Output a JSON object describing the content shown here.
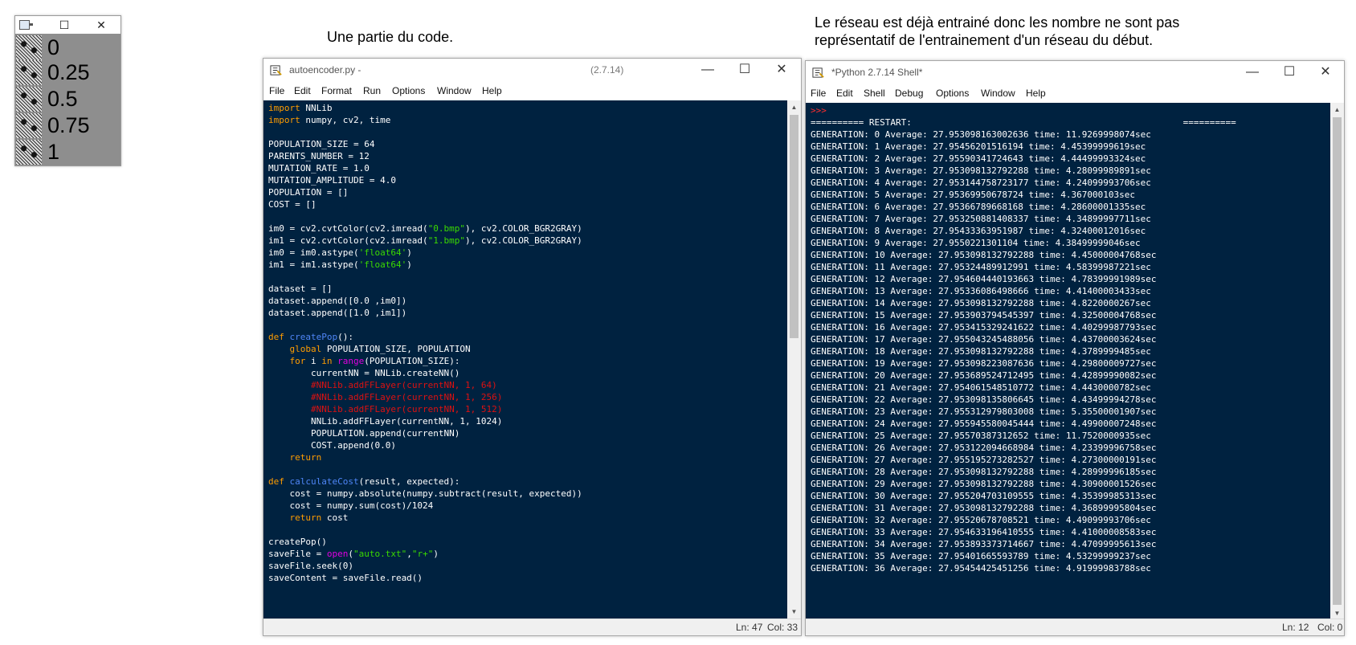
{
  "captions": {
    "code_note": "Une partie du code.",
    "shell_note_line1": "Le réseau est déjà entrainé donc les nombre ne sont pas",
    "shell_note_line2": "représentatif de l'entrainement d'un réseau du début."
  },
  "preview_window": {
    "minimize": "☐",
    "close": "✕",
    "rows": [
      "0",
      "0.25",
      "0.5",
      "0.75",
      "1"
    ]
  },
  "editor": {
    "title": "autoencoder.py -",
    "version": "(2.7.14)",
    "menu": [
      "File",
      "Edit",
      "Format",
      "Run",
      "Options",
      "Window",
      "Help"
    ],
    "status_ln": "Ln: 47",
    "status_col": "Col: 33",
    "colors": {
      "background": "#002240",
      "keyword": "#ff9d00",
      "builtin": "#e000e0",
      "def_name": "#4f86f7",
      "string": "#3ad900",
      "comment": "#dd1111"
    }
  },
  "shell": {
    "title": "*Python 2.7.14 Shell*",
    "menu": [
      "File",
      "Edit",
      "Shell",
      "Debug",
      "Options",
      "Window",
      "Help"
    ],
    "prompt": ">>>",
    "restart": "========== RESTART:                                                   ==========",
    "lines": [
      "GENERATION: 0 Average: 27.953098163002636 time: 11.9269998074sec",
      "GENERATION: 1 Average: 27.95456201516194 time: 4.45399999619sec",
      "GENERATION: 2 Average: 27.95590341724643 time: 4.44499993324sec",
      "GENERATION: 3 Average: 27.953098132792288 time: 4.28099989891sec",
      "GENERATION: 4 Average: 27.953144758723177 time: 4.24099993706sec",
      "GENERATION: 5 Average: 27.95369950678724 time: 4.367000103sec",
      "GENERATION: 6 Average: 27.95366789668168 time: 4.28600001335sec",
      "GENERATION: 7 Average: 27.953250881408337 time: 4.34899997711sec",
      "GENERATION: 8 Average: 27.95433363951987 time: 4.32400012016sec",
      "GENERATION: 9 Average: 27.9550221301104 time: 4.38499999046sec",
      "GENERATION: 10 Average: 27.953098132792288 time: 4.45000004768sec",
      "GENERATION: 11 Average: 27.95324489912991 time: 4.58399987221sec",
      "GENERATION: 12 Average: 27.954604440193663 time: 4.78399991989sec",
      "GENERATION: 13 Average: 27.95336086498666 time: 4.41400003433sec",
      "GENERATION: 14 Average: 27.953098132792288 time: 4.8220000267sec",
      "GENERATION: 15 Average: 27.953903794545397 time: 4.32500004768sec",
      "GENERATION: 16 Average: 27.953415329241622 time: 4.40299987793sec",
      "GENERATION: 17 Average: 27.955043245488056 time: 4.43700003624sec",
      "GENERATION: 18 Average: 27.953098132792288 time: 4.3789999485sec",
      "GENERATION: 19 Average: 27.953098223087636 time: 4.29800009727sec",
      "GENERATION: 20 Average: 27.953689524712495 time: 4.42899990082sec",
      "GENERATION: 21 Average: 27.954061548510772 time: 4.4430000782sec",
      "GENERATION: 22 Average: 27.953098135806645 time: 4.43499994278sec",
      "GENERATION: 23 Average: 27.955312979803008 time: 5.35500001907sec",
      "GENERATION: 24 Average: 27.955945580045444 time: 4.49900007248sec",
      "GENERATION: 25 Average: 27.95570387312652 time: 11.7520000935sec",
      "GENERATION: 26 Average: 27.953122094668984 time: 4.23399996758sec",
      "GENERATION: 27 Average: 27.955195273282527 time: 4.27300000191sec",
      "GENERATION: 28 Average: 27.953098132792288 time: 4.28999996185sec",
      "GENERATION: 29 Average: 27.953098132792288 time: 4.30900001526sec",
      "GENERATION: 30 Average: 27.955204703109555 time: 4.35399985313sec",
      "GENERATION: 31 Average: 27.953098132792288 time: 4.36899995804sec",
      "GENERATION: 32 Average: 27.95520678708521 time: 4.49099993706sec",
      "GENERATION: 33 Average: 27.954633196410555 time: 4.41000008583sec",
      "GENERATION: 34 Average: 27.953893373714667 time: 4.47099995613sec",
      "GENERATION: 35 Average: 27.95401665593789 time: 4.53299999237sec",
      "GENERATION: 36 Average: 27.95454425451256 time: 4.91999983788sec"
    ],
    "status_ln": "Ln: 12",
    "status_col": "Col: 0"
  }
}
